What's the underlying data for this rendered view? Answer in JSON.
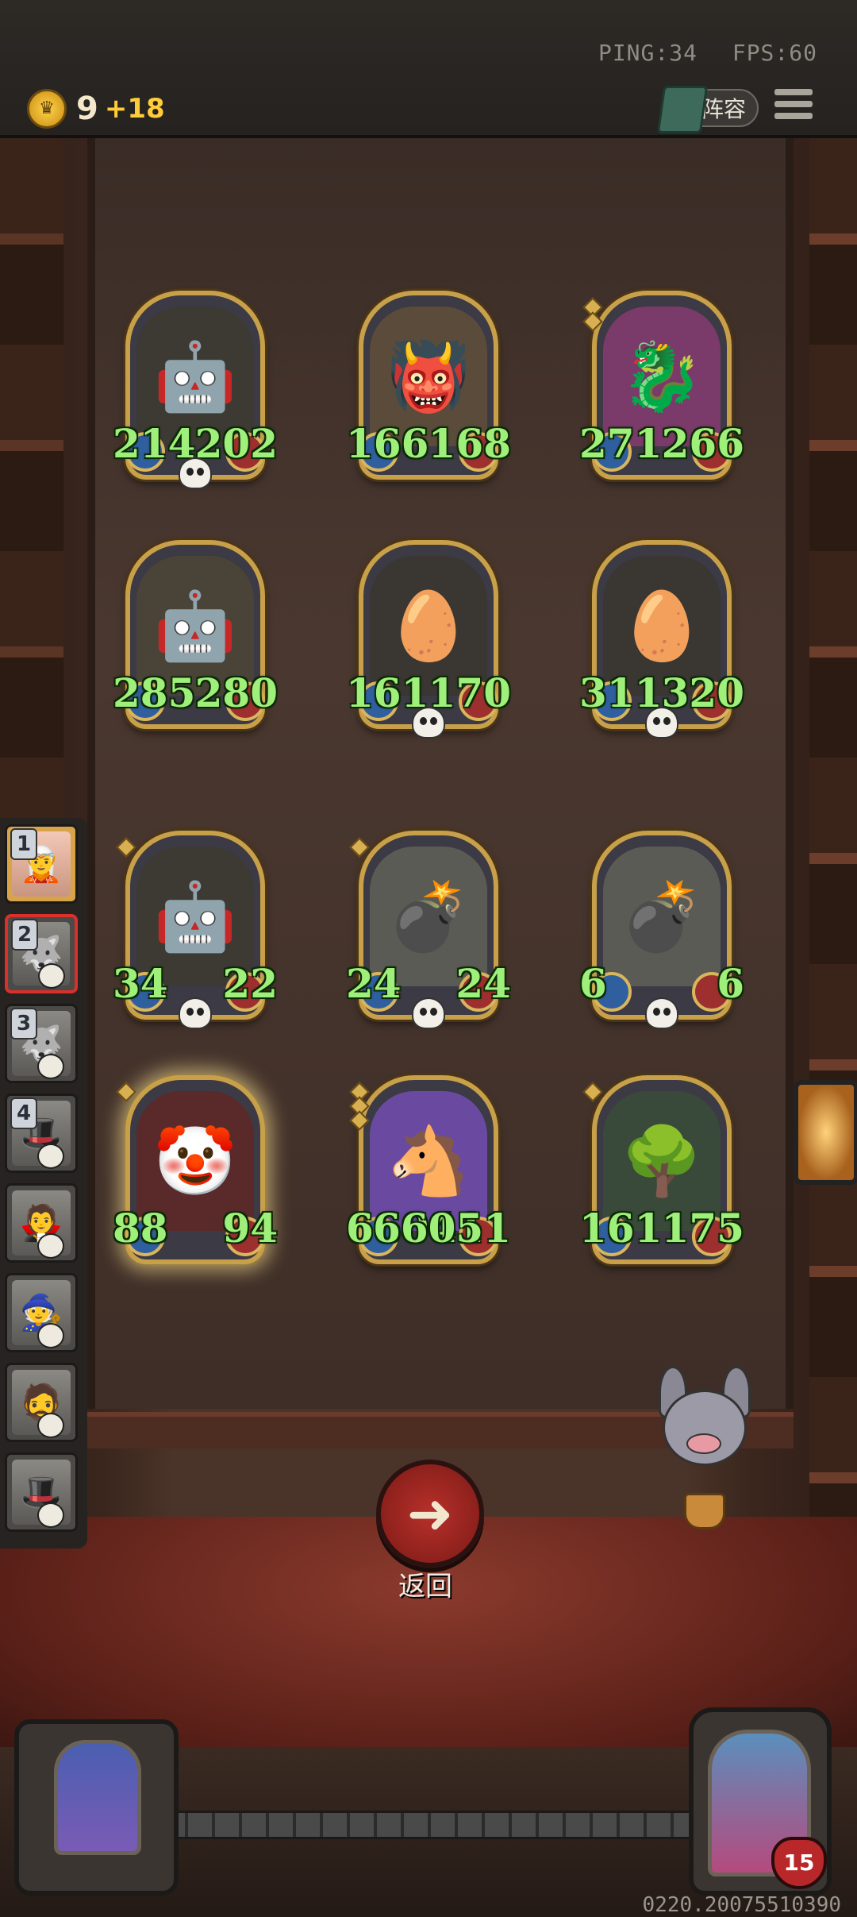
{
  "header": {
    "ping_label": "PING:34",
    "fps_label": "FPS:60",
    "gold": "9",
    "gold_income": "+18",
    "lineup_label": "阵容"
  },
  "board": {
    "cards": [
      {
        "name": "robot-duo",
        "icon": "🤖",
        "atk": "214",
        "hp": "202",
        "skull": true,
        "tier": 0,
        "bg": "#3d3a33"
      },
      {
        "name": "beast-demon",
        "icon": "👹",
        "atk": "166",
        "hp": "168",
        "skull": false,
        "tier": 0,
        "bg": "#5a4b3a"
      },
      {
        "name": "red-dragon",
        "icon": "🐉",
        "atk": "271",
        "hp": "266",
        "skull": false,
        "tier": 2,
        "bg": "#7a3a6a"
      },
      {
        "name": "robot-knight",
        "icon": "🤖",
        "atk": "285",
        "hp": "280",
        "skull": false,
        "tier": 0,
        "bg": "#4a4438"
      },
      {
        "name": "spotted-egg",
        "icon": "🥚",
        "atk": "161",
        "hp": "170",
        "skull": true,
        "tier": 0,
        "bg": "#3a3632"
      },
      {
        "name": "spotted-egg",
        "icon": "🥚",
        "atk": "311",
        "hp": "320",
        "skull": true,
        "tier": 0,
        "bg": "#3a3632"
      },
      {
        "name": "robot-duo",
        "icon": "🤖",
        "atk": "34",
        "hp": "22",
        "skull": true,
        "tier": 1,
        "bg": "#3d3a33"
      },
      {
        "name": "bomb-knight",
        "icon": "💣",
        "atk": "24",
        "hp": "24",
        "skull": true,
        "tier": 1,
        "bg": "#5b5b55"
      },
      {
        "name": "bomb-knight",
        "icon": "💣",
        "atk": "6",
        "hp": "6",
        "skull": true,
        "tier": 0,
        "bg": "#5b5b55"
      },
      {
        "name": "jester",
        "icon": "🤡",
        "atk": "88",
        "hp": "94",
        "skull": false,
        "tier": 1,
        "bg": "#5a2a2a"
      },
      {
        "name": "fire-horse",
        "icon": "🐴",
        "atk": "66041",
        "hp": "66051",
        "skull": false,
        "tier": 3,
        "bg": "#6a4aa0"
      },
      {
        "name": "tree-ent",
        "icon": "🌳",
        "atk": "161",
        "hp": "175",
        "skull": false,
        "tier": 1,
        "bg": "#3a4a3a"
      }
    ]
  },
  "sidebar": {
    "slots": [
      {
        "label": "1",
        "icon": "🧝",
        "state": "gold"
      },
      {
        "label": "2",
        "icon": "🐺",
        "state": "selected"
      },
      {
        "label": "3",
        "icon": "🐺",
        "state": "dead"
      },
      {
        "label": "4",
        "icon": "🎩",
        "state": "dead"
      },
      {
        "label": "",
        "icon": "🧛",
        "state": "dead"
      },
      {
        "label": "",
        "icon": "🧙",
        "state": "dead"
      },
      {
        "label": "",
        "icon": "🧔",
        "state": "dead"
      },
      {
        "label": "",
        "icon": "🎩",
        "state": "dead"
      }
    ]
  },
  "actions": {
    "back_label": "返回",
    "back_icon": "arrow-left-icon"
  },
  "player": {
    "level": "15"
  },
  "footer": {
    "build": "0220.20075510390"
  }
}
